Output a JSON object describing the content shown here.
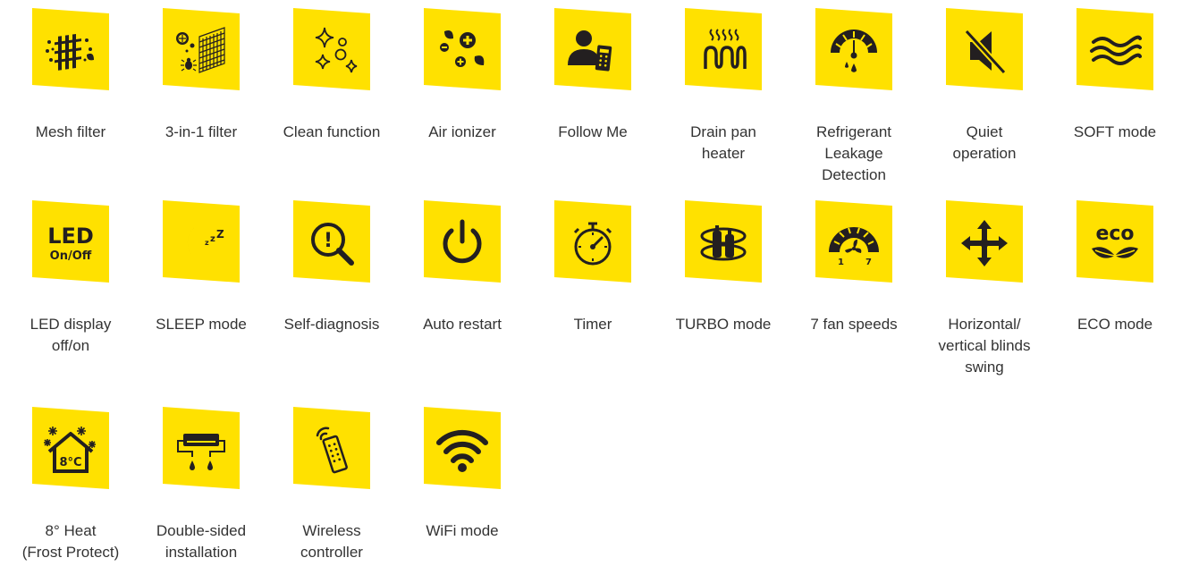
{
  "theme": {
    "tile_color": "#ffe100",
    "icon_color": "#231f20",
    "label_color": "#333333"
  },
  "features": [
    {
      "label": "Mesh filter",
      "icon": "mesh-filter-icon"
    },
    {
      "label": "3-in-1 filter",
      "icon": "three-in-one-filter-icon"
    },
    {
      "label": "Clean function",
      "icon": "clean-sparkle-icon"
    },
    {
      "label": "Air ionizer",
      "icon": "ionizer-icon"
    },
    {
      "label": "Follow Me",
      "icon": "person-remote-icon"
    },
    {
      "label": "Drain pan\nheater",
      "icon": "heater-coil-icon"
    },
    {
      "label": "Refrigerant\nLeakage\nDetection",
      "icon": "pressure-gauge-icon"
    },
    {
      "label": "Quiet\noperation",
      "icon": "speaker-muted-icon"
    },
    {
      "label": "SOFT mode",
      "icon": "waves-icon"
    },
    {
      "label": "LED display\noff/on",
      "icon": "led-onoff-icon",
      "icon_text": [
        "LED",
        "On/Off"
      ]
    },
    {
      "label": "SLEEP mode",
      "icon": "moon-zzz-icon",
      "icon_text": [
        "z",
        "z",
        "Z"
      ]
    },
    {
      "label": "Self-diagnosis",
      "icon": "magnifier-alert-icon",
      "icon_text": [
        "!"
      ]
    },
    {
      "label": "Auto restart",
      "icon": "power-icon"
    },
    {
      "label": "Timer",
      "icon": "stopwatch-icon"
    },
    {
      "label": "TURBO mode",
      "icon": "turbo-compressor-icon"
    },
    {
      "label": "7 fan speeds",
      "icon": "fan-speed-gauge-icon",
      "icon_text": [
        "1",
        "7"
      ]
    },
    {
      "label": "Horizontal/\nvertical blinds\nswing",
      "icon": "four-way-arrows-icon"
    },
    {
      "label": "ECO mode",
      "icon": "eco-leaves-icon",
      "icon_text": [
        "eco"
      ]
    },
    {
      "label": "8° Heat\n(Frost Protect)",
      "icon": "house-snowflake-icon",
      "icon_text": [
        "8°C"
      ]
    },
    {
      "label": "Double-sided\ninstallation",
      "icon": "ac-unit-drain-icon"
    },
    {
      "label": "Wireless\ncontroller",
      "icon": "remote-control-icon"
    },
    {
      "label": "WiFi mode",
      "icon": "wifi-icon"
    }
  ]
}
